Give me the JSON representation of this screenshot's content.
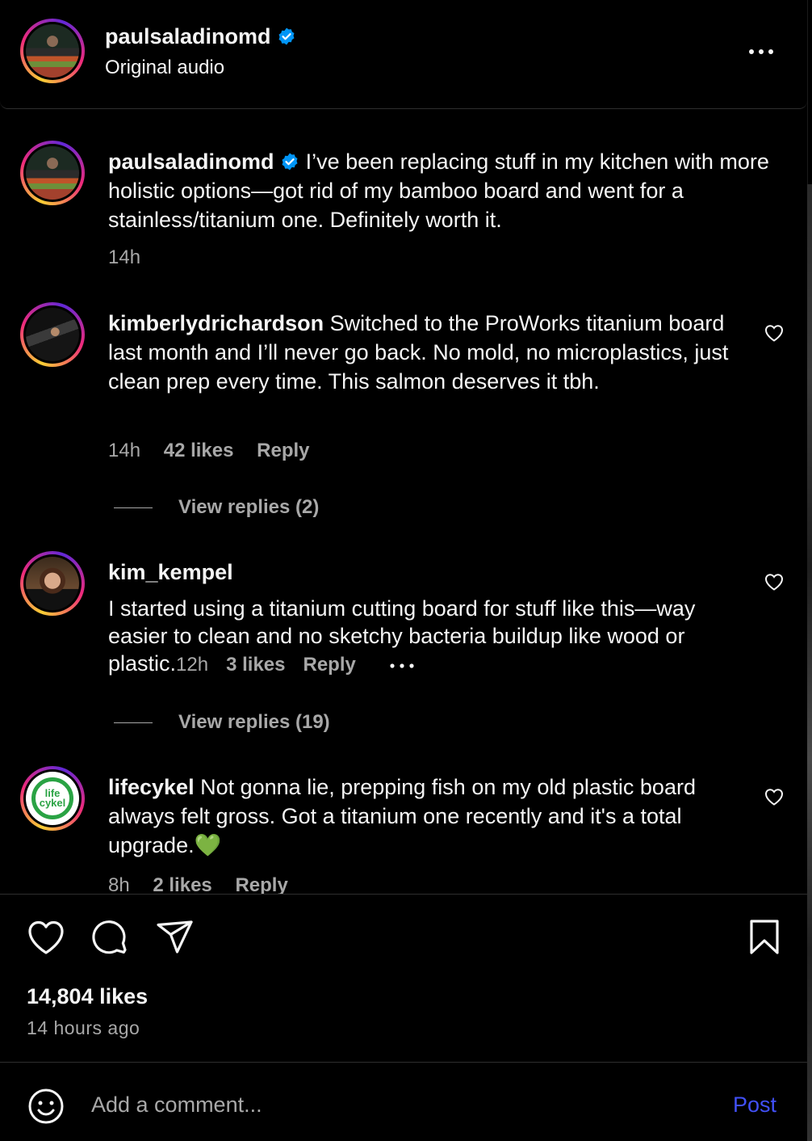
{
  "header": {
    "username": "paulsaladinomd",
    "subtitle": "Original audio",
    "more_icon": "more-horizontal-icon"
  },
  "caption": {
    "username": "paulsaladinomd",
    "text": "I’ve been replacing stuff in my kitchen with more holistic options—got rid of my bamboo board and went for a stainless/titanium one. Definitely worth it.",
    "time": "14h"
  },
  "comments": [
    {
      "username": "kimberlydrichardson",
      "text": "Switched to the ProWorks titanium board last month and I’ll never go back. No mold, no microplastics, just clean prep every time. This salmon deserves it tbh.",
      "time": "14h",
      "likes": "42 likes",
      "reply": "Reply",
      "view_replies": "View replies (2)"
    },
    {
      "username": "kim_kempel",
      "text": "I started using a titanium cutting board for stuff like this—way easier to clean and no sketchy bacteria buildup like wood or plastic.",
      "time": "12h",
      "likes": "3 likes",
      "reply": "Reply",
      "view_replies": "View replies (19)"
    },
    {
      "username": "lifecykel",
      "avatar_text": "life cykel",
      "text": "Not gonna lie, prepping fish on my old plastic board always felt gross. Got a titanium one recently and it's a total upgrade.💚",
      "time": "8h",
      "likes": "2 likes",
      "reply": "Reply"
    }
  ],
  "actions": {
    "like_icon": "heart-icon",
    "comment_icon": "comment-bubble-icon",
    "share_icon": "paper-plane-icon",
    "save_icon": "bookmark-icon"
  },
  "post_stats": {
    "likes": "14,804 likes",
    "time_ago": "14 hours ago"
  },
  "comment_box": {
    "placeholder": "Add a comment...",
    "post_label": "Post",
    "emoji_icon": "emoji-smiley-icon"
  },
  "colors": {
    "background": "#000000",
    "text_primary": "#f5f5f5",
    "text_secondary": "#a8a8a8",
    "verified_badge": "#0095f6",
    "post_button": "#4150f7"
  }
}
